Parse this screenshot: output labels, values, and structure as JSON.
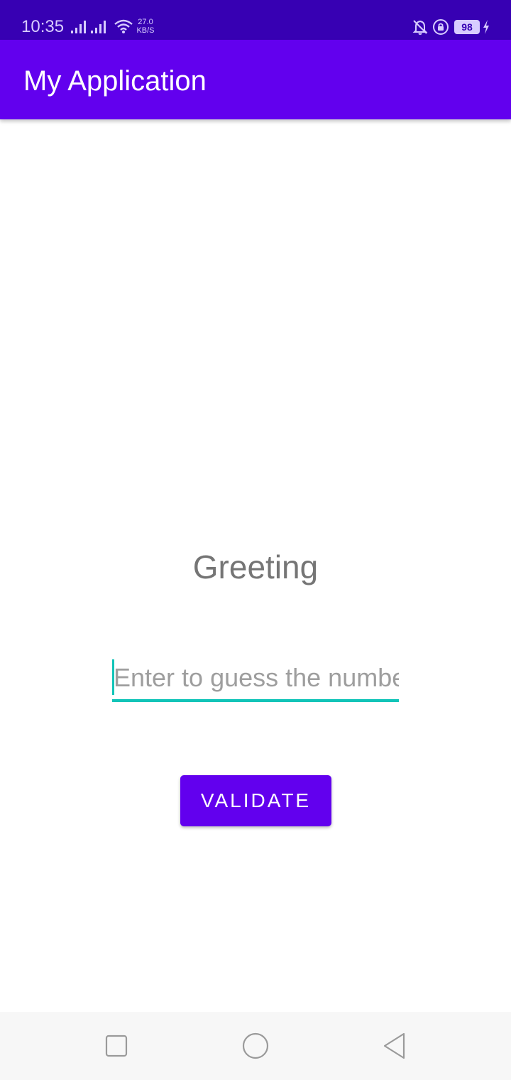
{
  "status_bar": {
    "time": "10:35",
    "net_speed_value": "27.0",
    "net_speed_unit": "KB/S",
    "battery": "98",
    "icons": [
      "signal-icon",
      "signal-icon",
      "wifi-icon",
      "bell-off-icon",
      "rotation-lock-icon",
      "battery-icon",
      "charging-icon"
    ]
  },
  "app_bar": {
    "title": "My Application"
  },
  "main": {
    "greeting": "Greeting",
    "guess_input": {
      "value": "",
      "placeholder": "Enter to guess the number"
    },
    "validate_label": "VALIDATE"
  },
  "nav_bar": {
    "buttons": [
      "recents-icon",
      "home-icon",
      "back-icon"
    ]
  },
  "colors": {
    "status_bar": "#3700b3",
    "primary": "#6200ee",
    "accent": "#12c4b8",
    "greeting_text": "#757575",
    "nav_bar": "#f7f7f7"
  }
}
